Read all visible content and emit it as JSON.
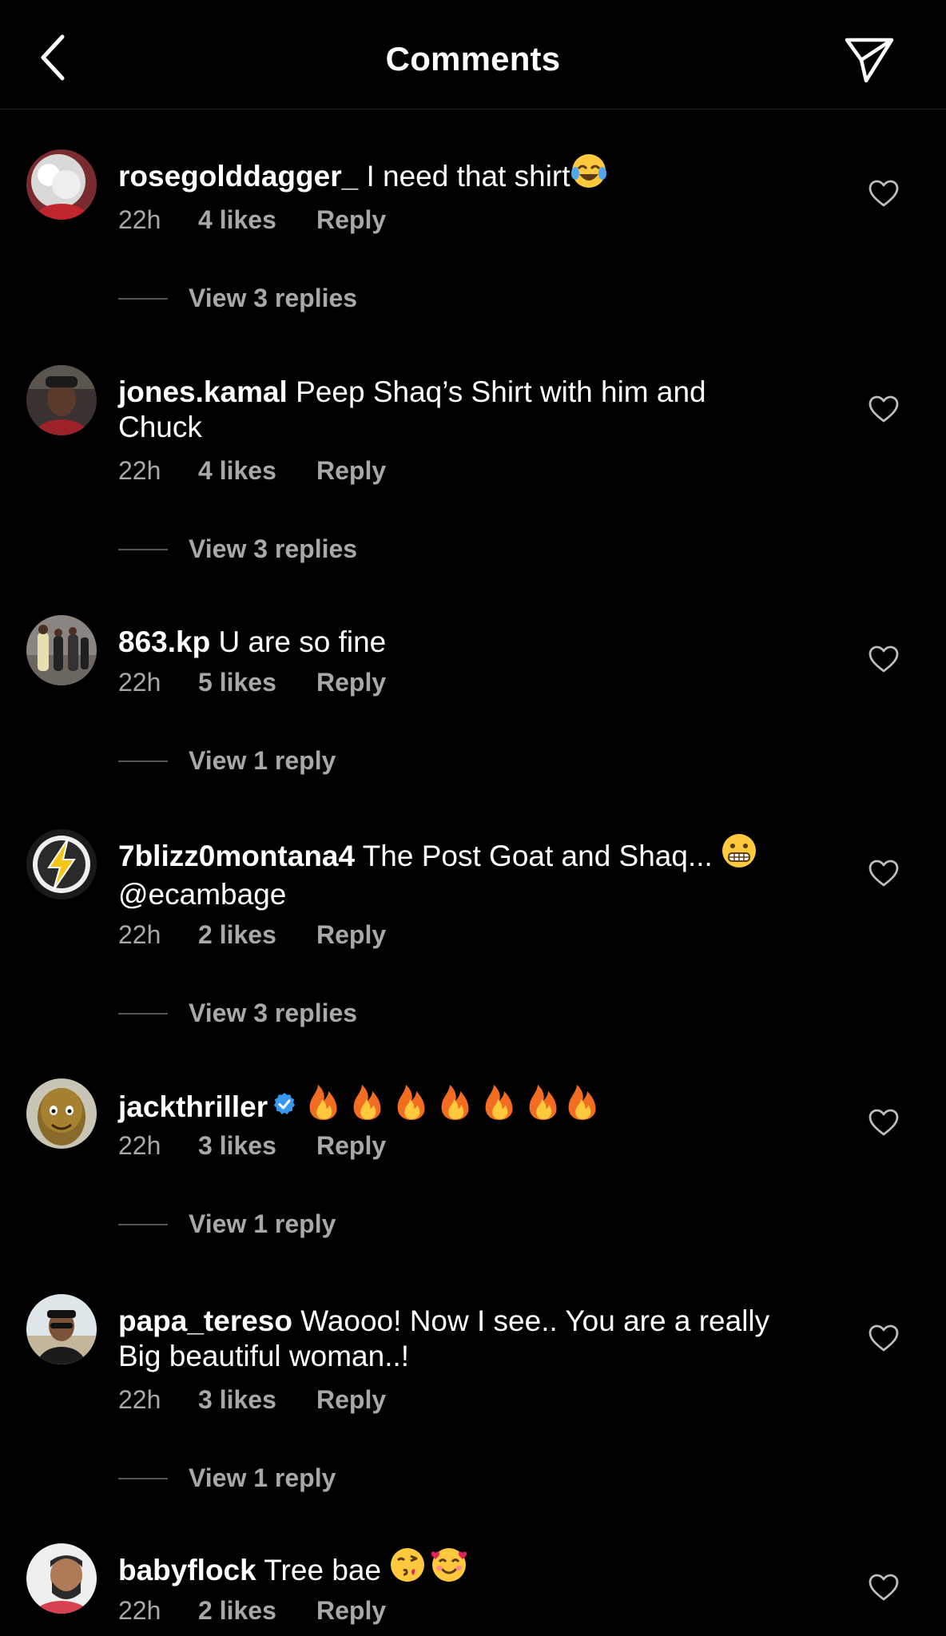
{
  "header": {
    "title": "Comments",
    "back_icon": "chevron-left-icon",
    "send_icon": "paper-plane-icon"
  },
  "colors": {
    "background": "#000000",
    "text_primary": "#ffffff",
    "text_secondary": "#a8a8a8",
    "verified_blue": "#3897f0"
  },
  "comments": [
    {
      "username": "rosegolddagger_",
      "text": " I need that shirt",
      "text_line2": "",
      "emoji": [
        "tears-of-joy-emoji"
      ],
      "time": "22h",
      "likes": "4 likes",
      "reply_label": "Reply",
      "view_replies": "View 3 replies",
      "verified": false
    },
    {
      "username": "jones.kamal",
      "text": " Peep Shaq’s Shirt with him and",
      "text_line2": "Chuck",
      "emoji": [],
      "time": "22h",
      "likes": "4 likes",
      "reply_label": "Reply",
      "view_replies": "View 3 replies",
      "verified": false
    },
    {
      "username": "863.kp",
      "text": " U are so fine",
      "text_line2": "",
      "emoji": [],
      "time": "22h",
      "likes": "5 likes",
      "reply_label": "Reply",
      "view_replies": "View 1 reply",
      "verified": false
    },
    {
      "username": "7blizz0montana4",
      "text": " The Post Goat and Shaq... ",
      "text_line2": "@ecambage",
      "emoji": [
        "grimacing-face-emoji"
      ],
      "time": "22h",
      "likes": "2 likes",
      "reply_label": "Reply",
      "view_replies": "View 3 replies",
      "verified": false
    },
    {
      "username": "jackthriller",
      "text": "",
      "text_line2": "",
      "emoji": [
        "fire-emoji",
        "fire-emoji",
        "fire-emoji",
        "fire-emoji",
        "fire-emoji",
        "fire-emoji",
        "fire-emoji"
      ],
      "time": "22h",
      "likes": "3 likes",
      "reply_label": "Reply",
      "view_replies": "View 1 reply",
      "verified": true
    },
    {
      "username": "papa_tereso",
      "text": " Waooo! Now I see.. You are a really",
      "text_line2": "Big beautiful woman..!",
      "emoji": [],
      "time": "22h",
      "likes": "3 likes",
      "reply_label": "Reply",
      "view_replies": "View 1 reply",
      "verified": false
    },
    {
      "username": "babyflock",
      "text": " Tree bae ",
      "text_line2": "",
      "emoji": [
        "face-blowing-kiss-emoji",
        "smiling-face-with-hearts-emoji"
      ],
      "time": "22h",
      "likes": "2 likes",
      "reply_label": "Reply",
      "view_replies": "",
      "verified": false
    }
  ]
}
